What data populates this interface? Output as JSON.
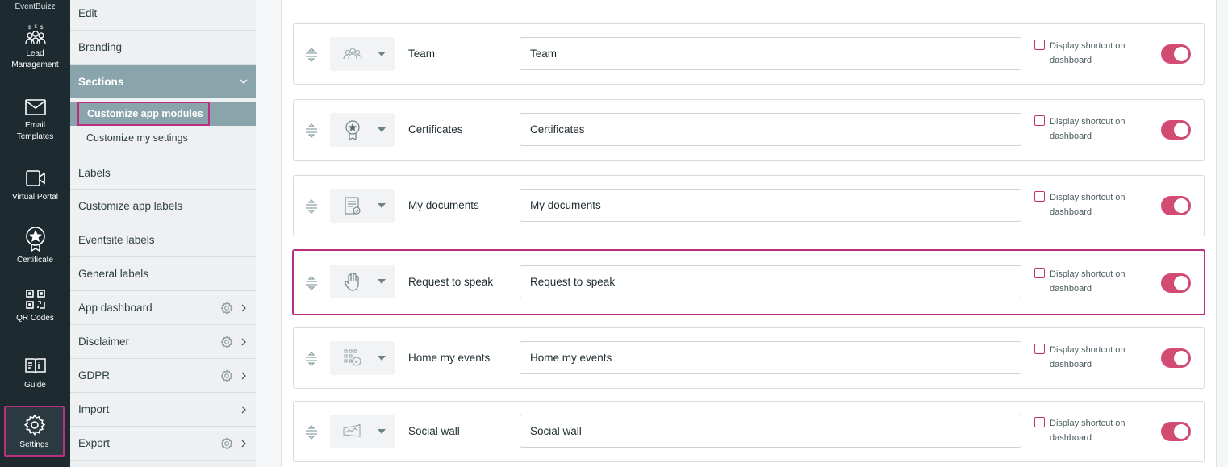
{
  "brand": "EventBuizz",
  "rail": [
    {
      "label": "Lead Management",
      "icon": "lead-management-icon"
    },
    {
      "label": "Email Templates",
      "icon": "email-icon"
    },
    {
      "label": "Virtual Portal",
      "icon": "video-camera-icon"
    },
    {
      "label": "Certificate",
      "icon": "certificate-icon"
    },
    {
      "label": "QR Codes",
      "icon": "qr-code-icon"
    },
    {
      "label": "Guide",
      "icon": "guide-book-icon"
    },
    {
      "label": "Settings",
      "icon": "gear-icon",
      "active": true
    }
  ],
  "menu": {
    "edit": "Edit",
    "branding": "Branding",
    "sections": "Sections",
    "customize_app_modules": "Customize app modules",
    "customize_my_settings": "Customize my settings",
    "labels": "Labels",
    "customize_app_labels": "Customize app labels",
    "eventsite_labels": "Eventsite labels",
    "general_labels": "General labels",
    "app_dashboard": "App dashboard",
    "disclaimer": "Disclaimer",
    "gdpr": "GDPR",
    "import": "Import",
    "export": "Export"
  },
  "modules": [
    {
      "name": "Team",
      "value": "Team",
      "icon": "team-icon",
      "shortcut_label": "Display shortcut on dashboard",
      "shortcut_checked": false,
      "enabled": true
    },
    {
      "name": "Certificates",
      "value": "Certificates",
      "icon": "certificate-icon",
      "shortcut_label": "Display shortcut on dashboard",
      "shortcut_checked": false,
      "enabled": true
    },
    {
      "name": "My documents",
      "value": "My documents",
      "icon": "documents-icon",
      "shortcut_label": "Display shortcut on dashboard",
      "shortcut_checked": false,
      "enabled": true
    },
    {
      "name": "Request to speak",
      "value": "Request to speak",
      "icon": "raised-hand-icon",
      "shortcut_label": "Display shortcut on dashboard",
      "shortcut_checked": false,
      "enabled": true,
      "highlighted": true
    },
    {
      "name": "Home my events",
      "value": "Home my events",
      "icon": "grid-events-icon",
      "shortcut_label": "Display shortcut on dashboard",
      "shortcut_checked": false,
      "enabled": true
    },
    {
      "name": "Social wall",
      "value": "Social wall",
      "icon": "social-wall-icon",
      "shortcut_label": "Display shortcut on dashboard",
      "shortcut_checked": false,
      "enabled": true
    }
  ],
  "colors": {
    "accent": "#b8307f",
    "toggle": "#d14b73",
    "sidebar": "#1d2b30",
    "section": "#8aa4ab"
  }
}
